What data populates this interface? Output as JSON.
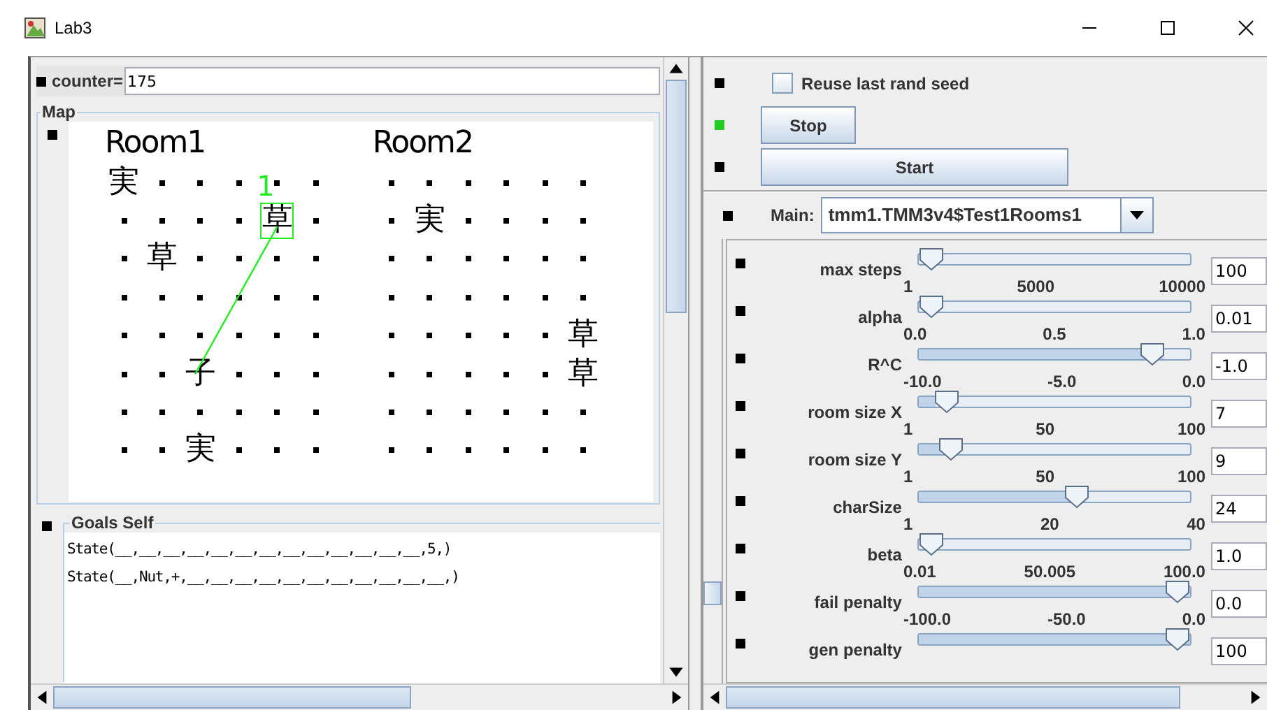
{
  "window": {
    "title": "Lab3"
  },
  "counter": {
    "label": "counter=",
    "value": "175"
  },
  "map": {
    "title": "Map",
    "rooms": [
      {
        "title": "Room1",
        "rows": [
          [
            {
              "kind": "glyph",
              "text": "実"
            },
            {
              "kind": "dot"
            },
            {
              "kind": "dot"
            },
            {
              "kind": "dot"
            },
            {
              "kind": "dot"
            },
            {
              "kind": "dot"
            }
          ],
          [
            {
              "kind": "dot"
            },
            {
              "kind": "dot"
            },
            {
              "kind": "dot"
            },
            {
              "kind": "dot"
            },
            {
              "kind": "agent",
              "text": "草",
              "label": "1"
            },
            {
              "kind": "dot"
            }
          ],
          [
            {
              "kind": "dot"
            },
            {
              "kind": "glyph",
              "text": "草"
            },
            {
              "kind": "dot"
            },
            {
              "kind": "dot"
            },
            {
              "kind": "dot"
            },
            {
              "kind": "dot"
            }
          ],
          [
            {
              "kind": "dot"
            },
            {
              "kind": "dot"
            },
            {
              "kind": "dot"
            },
            {
              "kind": "dot"
            },
            {
              "kind": "dot"
            },
            {
              "kind": "dot"
            }
          ],
          [
            {
              "kind": "dot"
            },
            {
              "kind": "dot"
            },
            {
              "kind": "dot"
            },
            {
              "kind": "dot"
            },
            {
              "kind": "dot"
            },
            {
              "kind": "dot"
            }
          ],
          [
            {
              "kind": "dot"
            },
            {
              "kind": "dot"
            },
            {
              "kind": "target",
              "text": "子"
            },
            {
              "kind": "dot"
            },
            {
              "kind": "dot"
            },
            {
              "kind": "dot"
            }
          ],
          [
            {
              "kind": "dot"
            },
            {
              "kind": "dot"
            },
            {
              "kind": "dot"
            },
            {
              "kind": "dot"
            },
            {
              "kind": "dot"
            },
            {
              "kind": "dot"
            }
          ],
          [
            {
              "kind": "dot"
            },
            {
              "kind": "dot"
            },
            {
              "kind": "glyph",
              "text": "実"
            },
            {
              "kind": "dot"
            },
            {
              "kind": "dot"
            },
            {
              "kind": "dot"
            }
          ]
        ]
      },
      {
        "title": "Room2",
        "rows": [
          [
            {
              "kind": "dot"
            },
            {
              "kind": "dot"
            },
            {
              "kind": "dot"
            },
            {
              "kind": "dot"
            },
            {
              "kind": "dot"
            },
            {
              "kind": "dot"
            }
          ],
          [
            {
              "kind": "dot"
            },
            {
              "kind": "glyph",
              "text": "実"
            },
            {
              "kind": "dot"
            },
            {
              "kind": "dot"
            },
            {
              "kind": "dot"
            },
            {
              "kind": "dot"
            }
          ],
          [
            {
              "kind": "dot"
            },
            {
              "kind": "dot"
            },
            {
              "kind": "dot"
            },
            {
              "kind": "dot"
            },
            {
              "kind": "dot"
            },
            {
              "kind": "dot"
            }
          ],
          [
            {
              "kind": "dot"
            },
            {
              "kind": "dot"
            },
            {
              "kind": "dot"
            },
            {
              "kind": "dot"
            },
            {
              "kind": "dot"
            },
            {
              "kind": "dot"
            }
          ],
          [
            {
              "kind": "dot"
            },
            {
              "kind": "dot"
            },
            {
              "kind": "dot"
            },
            {
              "kind": "dot"
            },
            {
              "kind": "dot"
            },
            {
              "kind": "glyph",
              "text": "草"
            }
          ],
          [
            {
              "kind": "dot"
            },
            {
              "kind": "dot"
            },
            {
              "kind": "dot"
            },
            {
              "kind": "dot"
            },
            {
              "kind": "dot"
            },
            {
              "kind": "glyph",
              "text": "草"
            }
          ],
          [
            {
              "kind": "dot"
            },
            {
              "kind": "dot"
            },
            {
              "kind": "dot"
            },
            {
              "kind": "dot"
            },
            {
              "kind": "dot"
            },
            {
              "kind": "dot"
            }
          ],
          [
            {
              "kind": "dot"
            },
            {
              "kind": "dot"
            },
            {
              "kind": "dot"
            },
            {
              "kind": "dot"
            },
            {
              "kind": "dot"
            },
            {
              "kind": "dot"
            }
          ]
        ]
      }
    ]
  },
  "goals": {
    "title": "Goals Self",
    "lines": [
      "State(__,__,__,__,__,__,__,__,__,__,__,__,__,5,)",
      "State(__,Nut,+,__,__,__,__,__,__,__,__,__,__,__,)"
    ]
  },
  "checkbox": {
    "label": "Reuse last rand seed",
    "checked": false
  },
  "buttons": [
    {
      "label": "Stop",
      "active": true,
      "kind": "short"
    },
    {
      "label": "Start",
      "active": false,
      "kind": "wide"
    }
  ],
  "main": {
    "label": "Main:",
    "value": "tmm1.TMM3v4$Test1Rooms1"
  },
  "sliders": [
    {
      "label": "max steps",
      "ticks": [
        "1",
        "5000",
        "10000"
      ],
      "level": 0.0,
      "value": "100"
    },
    {
      "label": "alpha",
      "ticks": [
        "0.0",
        "0.5",
        "1.0"
      ],
      "level": 0.0,
      "value": "0.01"
    },
    {
      "label": "R^C",
      "ticks": [
        "-10.0",
        "-5.0",
        "0.0"
      ],
      "level": 0.9,
      "value": "-1.0"
    },
    {
      "label": "room size X",
      "ticks": [
        "1",
        "50",
        "100"
      ],
      "level": 0.06,
      "value": "7"
    },
    {
      "label": "room size Y",
      "ticks": [
        "1",
        "50",
        "100"
      ],
      "level": 0.08,
      "value": "9"
    },
    {
      "label": "charSize",
      "ticks": [
        "1",
        "20",
        "40"
      ],
      "level": 0.59,
      "value": "24"
    },
    {
      "label": "beta",
      "ticks": [
        "0.01",
        "50.005",
        "100.0"
      ],
      "level": 0.0,
      "value": "1.0"
    },
    {
      "label": "fail penalty",
      "ticks": [
        "-100.0",
        "-50.0",
        "0.0"
      ],
      "level": 1.0,
      "value": "0.0"
    },
    {
      "label": "gen penalty",
      "level": 1.0,
      "value": "100"
    }
  ]
}
